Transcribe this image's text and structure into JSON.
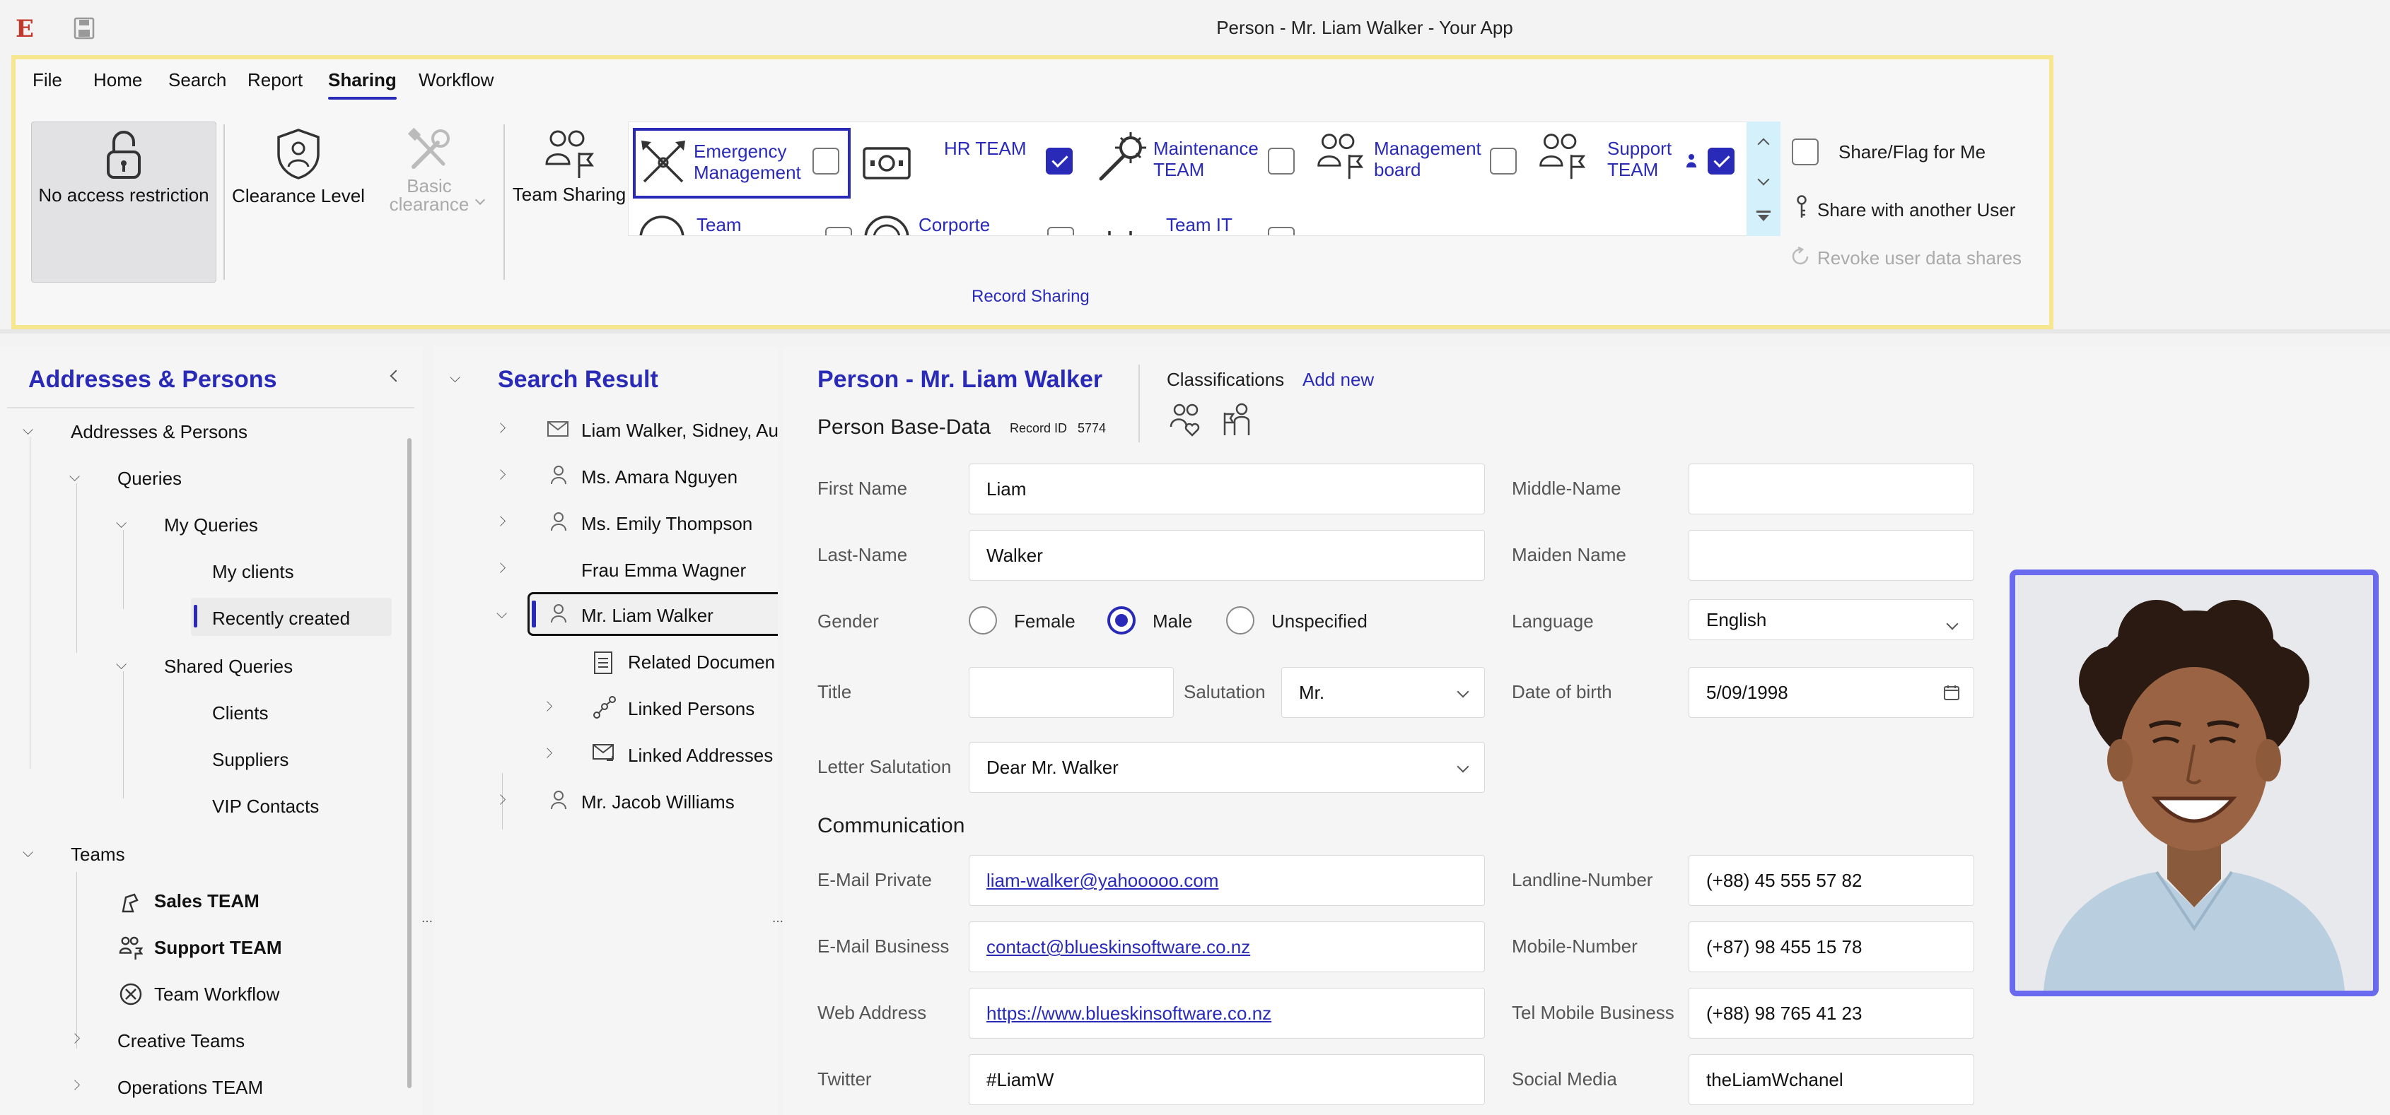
{
  "window": {
    "title": "Person - Mr. Liam Walker  - Your App"
  },
  "menu": {
    "file": "File",
    "home": "Home",
    "search": "Search",
    "report": "Report",
    "sharing": "Sharing",
    "workflow": "Workflow"
  },
  "ribbon": {
    "no_access": "No access restriction",
    "clearance_level": "Clearance Level",
    "basic_clearance_1": "Basic",
    "basic_clearance_2": "clearance",
    "team_sharing": "Team Sharing",
    "teams": [
      {
        "l1": "Emergency",
        "l2": "Management",
        "checked": false
      },
      {
        "l1": "HR TEAM",
        "l2": "",
        "checked": true
      },
      {
        "l1": "Maintenance",
        "l2": "TEAM",
        "checked": false
      },
      {
        "l1": "Management",
        "l2": "board",
        "checked": false
      },
      {
        "l1": "Support",
        "l2": "TEAM",
        "checked": true
      },
      {
        "l1": "Team",
        "l2": "",
        "checked": false
      },
      {
        "l1": "Corporte",
        "l2": "",
        "checked": false
      },
      {
        "l1": "Team IT",
        "l2": "",
        "checked": false
      }
    ],
    "share_flag": "Share/Flag for Me",
    "share_another": "Share with another User",
    "revoke": "Revoke user data shares",
    "group_label": "Record Sharing"
  },
  "left": {
    "title": "Addresses & Persons",
    "items": [
      "Addresses & Persons",
      "Queries",
      "My Queries",
      "My clients",
      "Recently created",
      "Shared Queries",
      "Clients",
      "Suppliers",
      "VIP Contacts",
      "Teams",
      "Sales TEAM",
      "Support TEAM",
      "Team Workflow",
      "Creative Teams",
      "Operations TEAM"
    ]
  },
  "search": {
    "title": "Search Result",
    "items": [
      "Liam Walker, Sidney, Au",
      "Ms. Amara Nguyen",
      "Ms. Emily Thompson",
      "Frau Emma Wagner",
      "Mr. Liam Walker",
      "Related Documen",
      "Linked Persons",
      "Linked Addresses",
      "Mr. Jacob Williams"
    ]
  },
  "form": {
    "heading": "Person - Mr. Liam Walker",
    "classifications": "Classifications",
    "add_new": "Add new",
    "base_data": "Person Base-Data",
    "record_id_label": "Record ID",
    "record_id": "5774",
    "first_name_label": "First Name",
    "first_name": "Liam",
    "middle_name_label": "Middle-Name",
    "middle_name": "",
    "last_name_label": "Last-Name",
    "last_name": "Walker",
    "maiden_name_label": "Maiden Name",
    "maiden_name": "",
    "gender_label": "Gender",
    "female": "Female",
    "male": "Male",
    "unspecified": "Unspecified",
    "gender_value": "Male",
    "language_label": "Language",
    "language": "English",
    "title_label": "Title",
    "title": "",
    "salutation_label": "Salutation",
    "salutation": "Mr.",
    "dob_label": "Date of birth",
    "dob": "5/09/1998",
    "letter_salutation_label": "Letter Salutation",
    "letter_salutation": "Dear Mr. Walker",
    "communication": "Communication",
    "email_private_label": "E-Mail Private",
    "email_private": "liam-walker@yahooooo.com",
    "landline_label": "Landline-Number",
    "landline": "(+88) 45 555 57 82",
    "email_business_label": "E-Mail Business",
    "email_business": "contact@blueskinsoftware.co.nz",
    "mobile_label": "Mobile-Number",
    "mobile": "(+87) 98 455 15 78",
    "web_label": "Web Address",
    "web": "https://www.blueskinsoftware.co.nz",
    "tel_business_label": "Tel Mobile Business",
    "tel_business": "(+88) 98 765 41 23",
    "twitter_label": "Twitter",
    "twitter": "#LiamW",
    "social_label": "Social Media",
    "social": "theLiamWchanel"
  },
  "colors": {
    "accent": "#2a2ab8",
    "highlight": "#f7e690",
    "photo_border": "#6a6aee"
  }
}
